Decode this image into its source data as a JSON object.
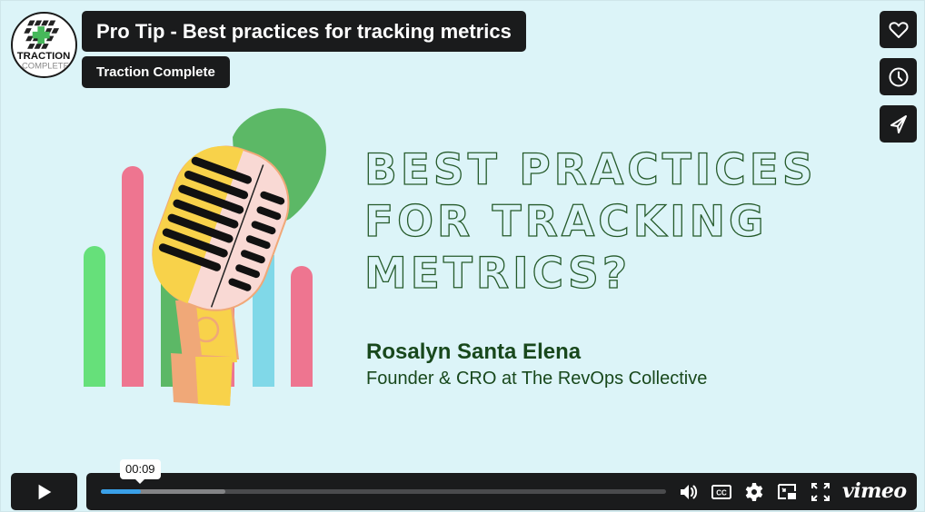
{
  "video": {
    "title": "Pro Tip - Best practices for tracking metrics",
    "channel": "Traction Complete",
    "logo_text_top": "TRACTION",
    "logo_text_bottom": "COMPLETE"
  },
  "side_actions": [
    {
      "name": "like",
      "icon": "heart-icon"
    },
    {
      "name": "watch-later",
      "icon": "clock-icon"
    },
    {
      "name": "share",
      "icon": "paper-plane-icon"
    }
  ],
  "slide": {
    "headline_lines": [
      "BEST PRACTICES",
      "FOR TRACKING",
      "METRICS?"
    ],
    "speaker_name": "Rosalyn Santa Elena",
    "speaker_role": "Founder & CRO at The RevOps Collective",
    "colors": {
      "background": "#dcf4f8",
      "headline_outline": "#255a2a",
      "speaker_text": "#18481c",
      "bar_green": "#66e07a",
      "bar_pink": "#ee7590",
      "bar_dark_green": "#5cb866",
      "bar_blue": "#80d8e8",
      "blob_green": "#5cb866",
      "mic_yellow": "#f8d24a",
      "mic_pink": "#f9d9d4"
    }
  },
  "player": {
    "current_time": "00:09",
    "progress_played": 0.07,
    "progress_buffered": 0.22,
    "controls": [
      {
        "name": "volume",
        "icon": "speaker-icon"
      },
      {
        "name": "captions",
        "icon": "cc-icon",
        "label": "CC"
      },
      {
        "name": "settings",
        "icon": "gear-icon"
      },
      {
        "name": "picture-in-picture",
        "icon": "pip-icon"
      },
      {
        "name": "fullscreen",
        "icon": "fullscreen-icon"
      }
    ],
    "brand": "vimeo",
    "accent_color": "#3aa0e8"
  }
}
